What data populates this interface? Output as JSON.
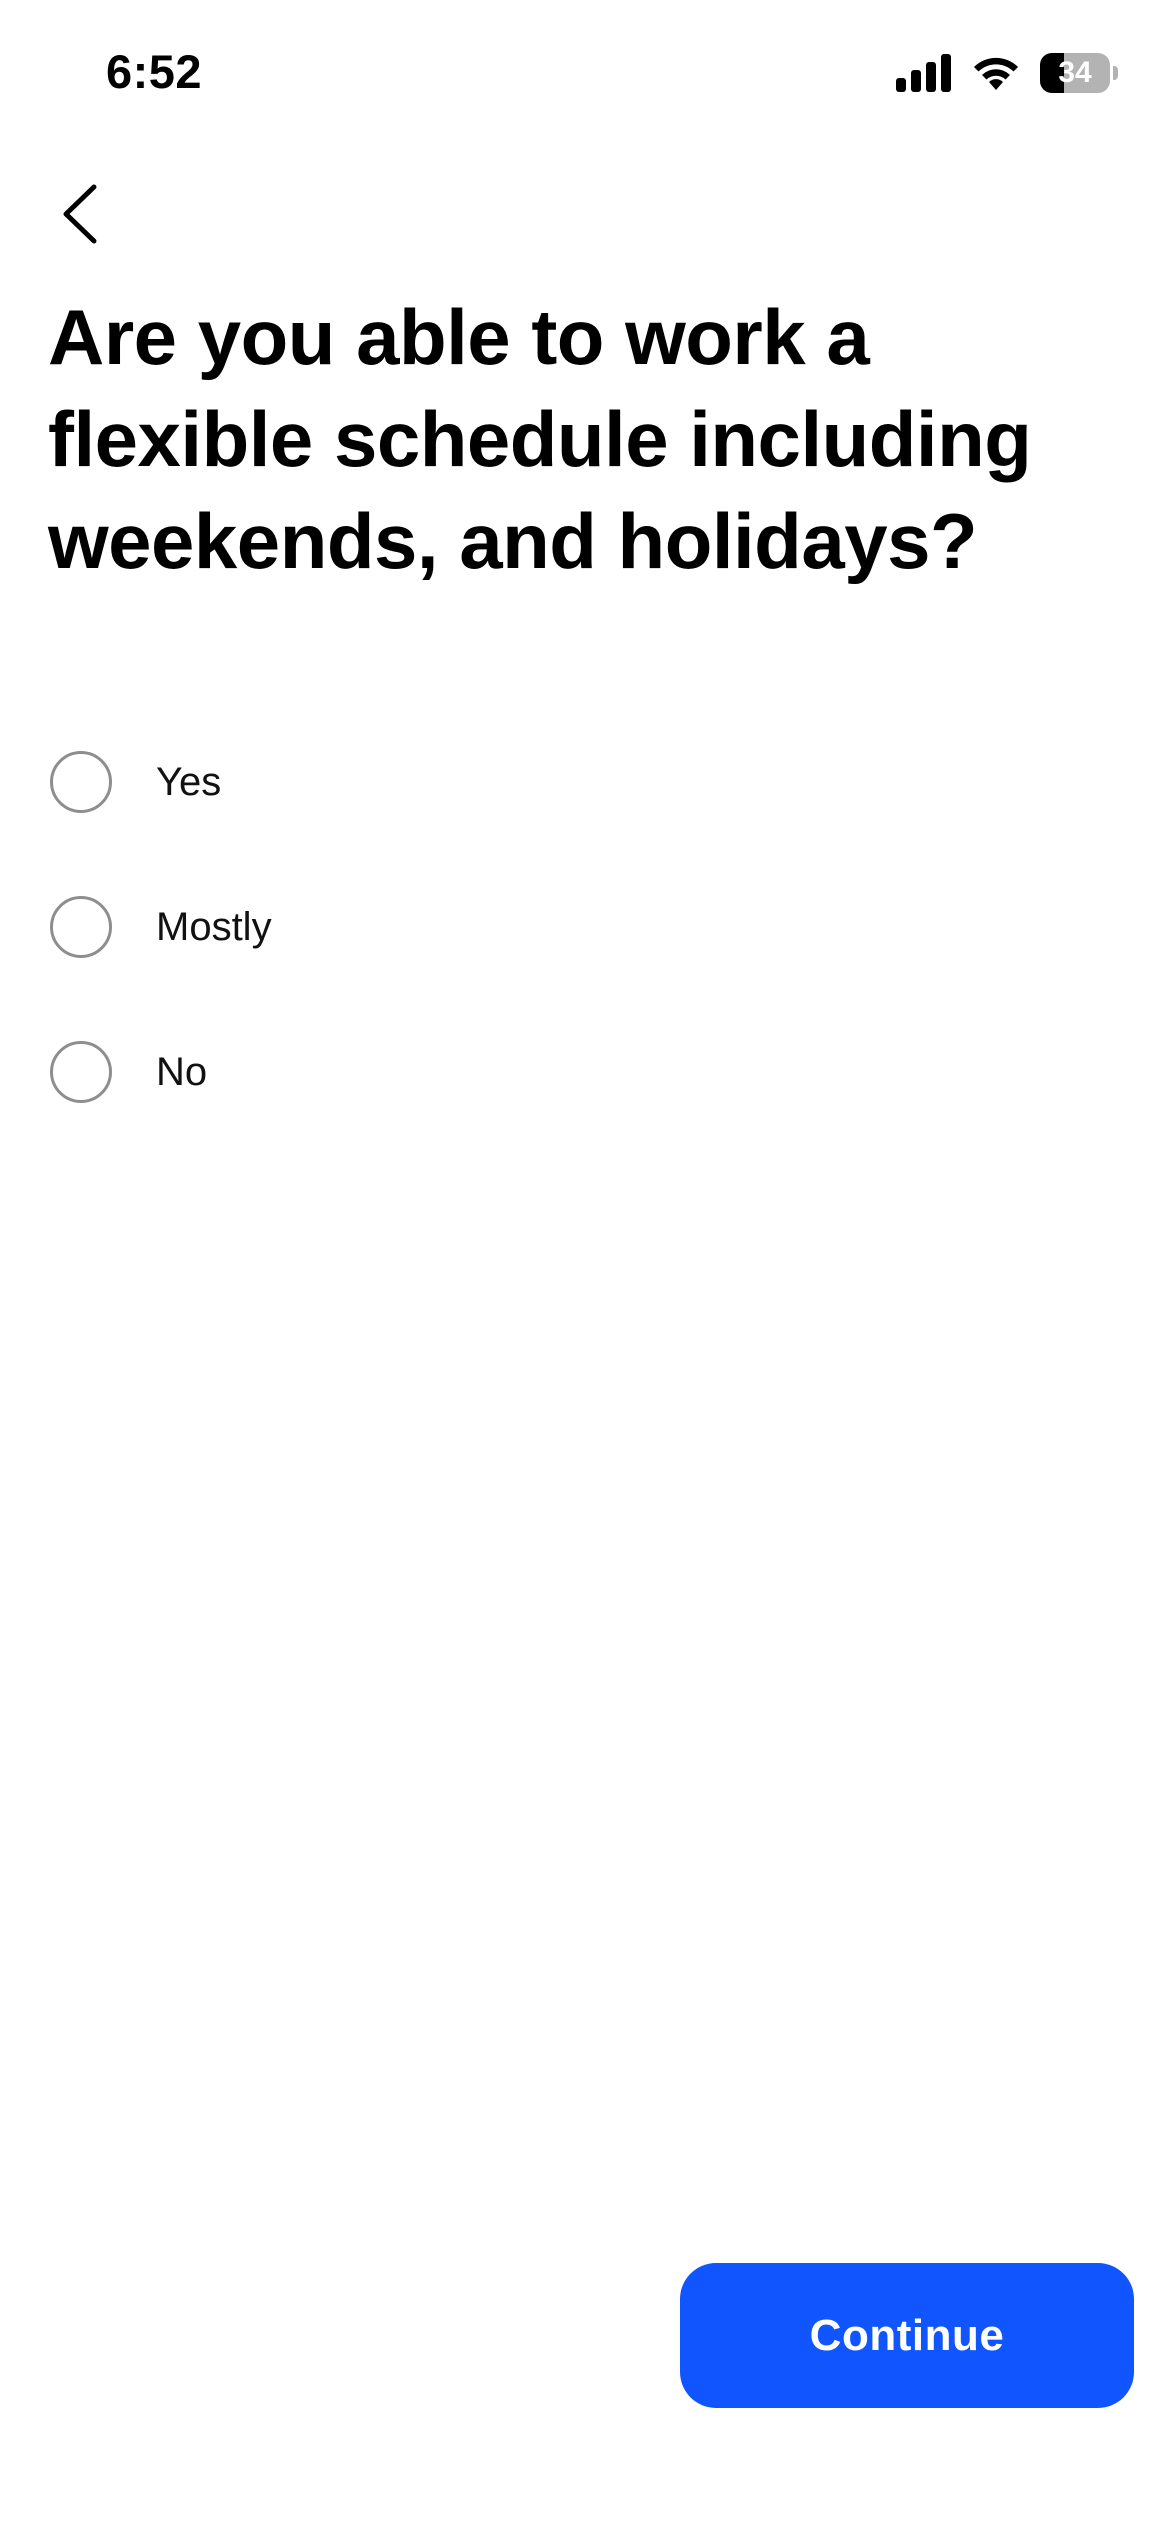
{
  "status_bar": {
    "time": "6:52",
    "battery_level": "34",
    "icons": [
      "signal-icon",
      "wifi-icon",
      "battery-icon"
    ]
  },
  "header": {
    "back_icon": "chevron-left-icon"
  },
  "question": {
    "title": "Are you able to work a flexible schedule including weekends, and holidays?"
  },
  "options": [
    {
      "label": "Yes",
      "selected": false
    },
    {
      "label": "Mostly",
      "selected": false
    },
    {
      "label": "No",
      "selected": false
    }
  ],
  "actions": {
    "continue_label": "Continue"
  },
  "colors": {
    "accent": "#1155ff",
    "radio_border": "#8e8e8e",
    "text": "#000000"
  }
}
